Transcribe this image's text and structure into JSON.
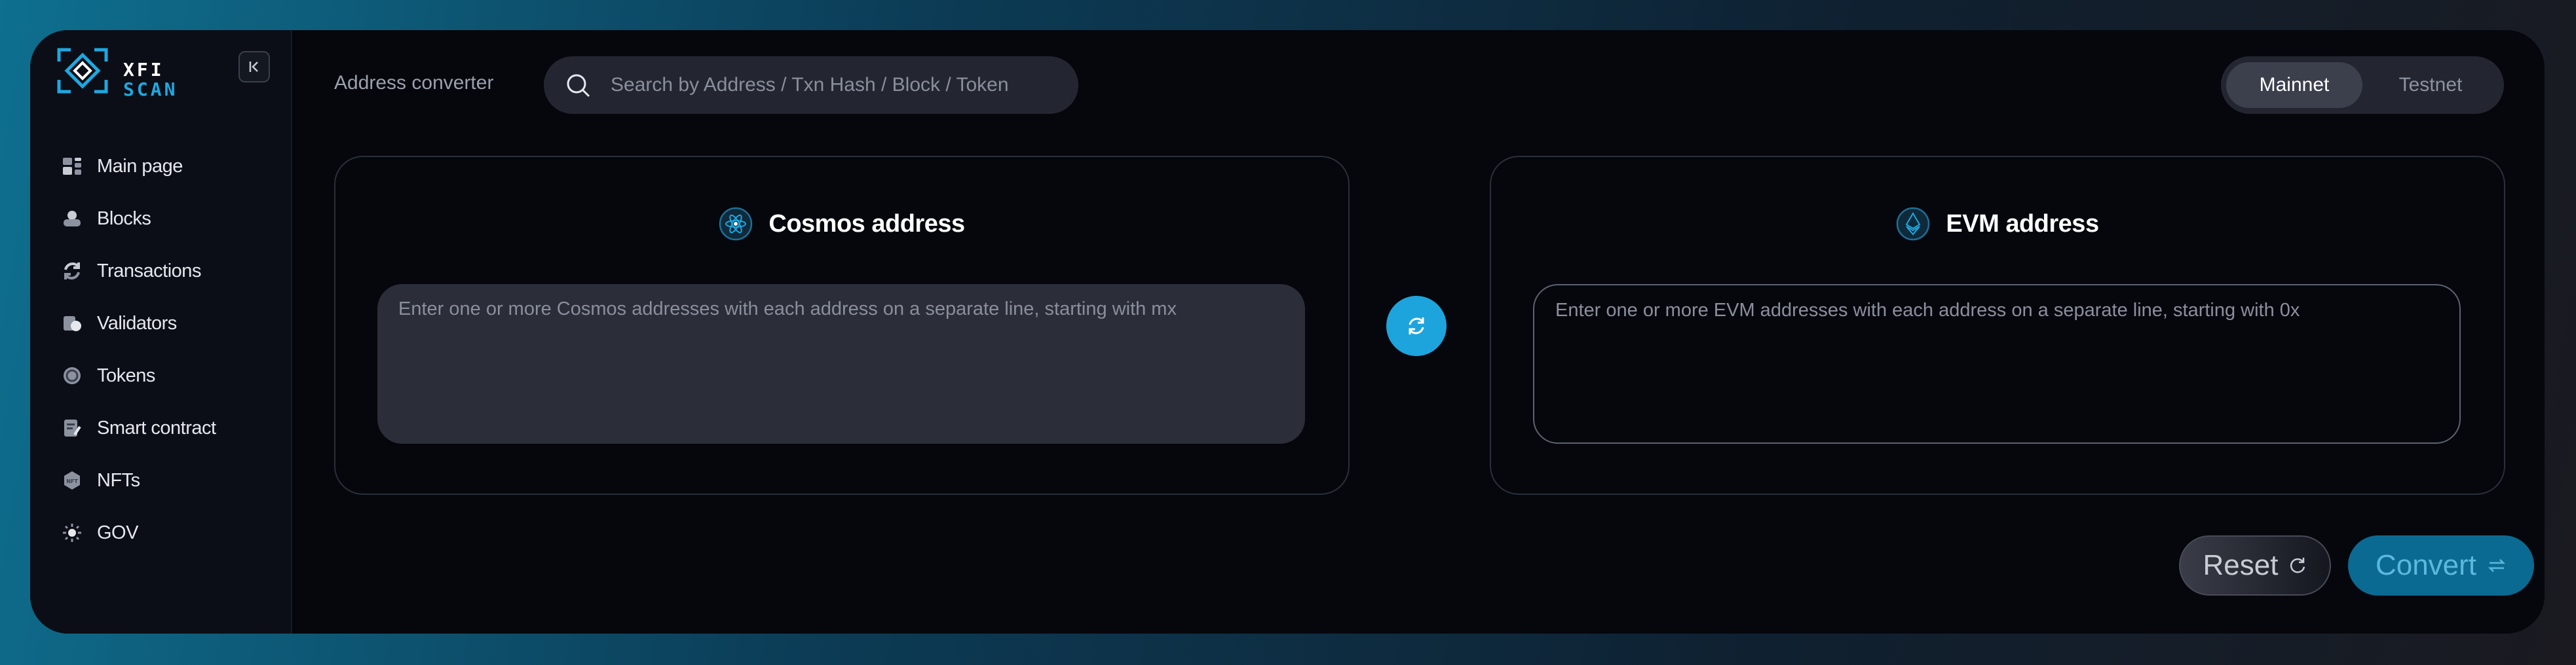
{
  "brand": {
    "line1": "XFI",
    "line2": "SCAN",
    "accent": "#1ea8e0"
  },
  "sidebar": {
    "collapse_icon": "collapse-left-icon",
    "items": [
      {
        "label": "Main page",
        "icon": "dashboard-icon"
      },
      {
        "label": "Blocks",
        "icon": "blocks-icon"
      },
      {
        "label": "Transactions",
        "icon": "transactions-icon"
      },
      {
        "label": "Validators",
        "icon": "validators-icon"
      },
      {
        "label": "Tokens",
        "icon": "tokens-icon"
      },
      {
        "label": "Smart contract",
        "icon": "smart-contract-icon"
      },
      {
        "label": "NFTs",
        "icon": "nft-icon"
      },
      {
        "label": "GOV",
        "icon": "gov-icon"
      }
    ]
  },
  "header": {
    "page_label": "Address converter",
    "search_placeholder": "Search by Address / Txn Hash / Block / Token",
    "network": {
      "options": [
        "Mainnet",
        "Testnet"
      ],
      "selected": "Mainnet"
    }
  },
  "converter": {
    "cosmos": {
      "title": "Cosmos address",
      "icon": "cosmos-icon",
      "placeholder": "Enter one or more Cosmos addresses with each address on a separate line, starting with mx"
    },
    "evm": {
      "title": "EVM address",
      "icon": "ethereum-icon",
      "placeholder": "Enter one or more EVM addresses with each address on a separate line, starting with 0x"
    },
    "swap_icon": "swap-icon",
    "reset_label": "Reset",
    "convert_label": "Convert"
  }
}
